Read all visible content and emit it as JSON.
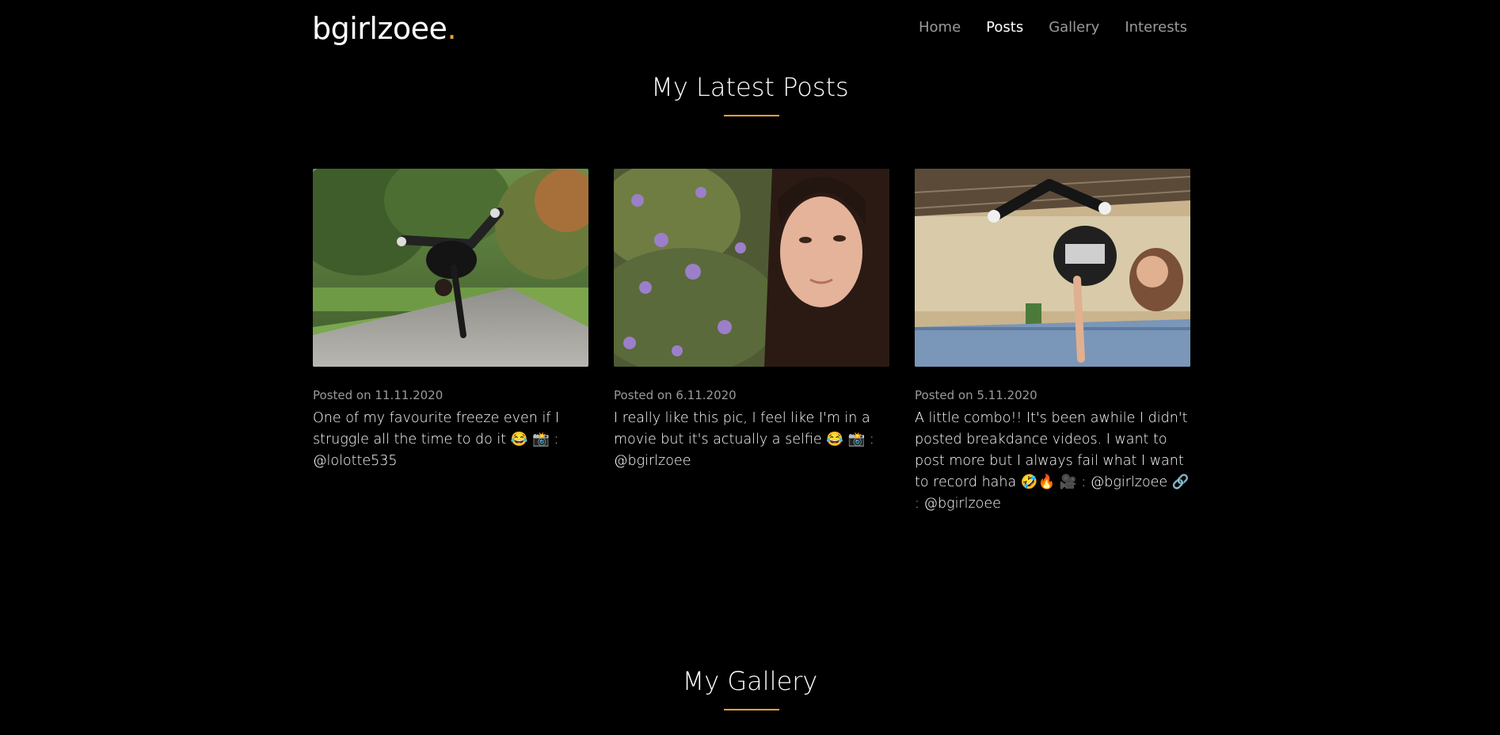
{
  "header": {
    "brand_text": "bgirlzoee",
    "brand_dot": ".",
    "nav": [
      {
        "label": "Home"
      },
      {
        "label": "Posts"
      },
      {
        "label": "Gallery"
      },
      {
        "label": "Interests"
      }
    ]
  },
  "posts_section": {
    "title": "My Latest Posts",
    "posts": [
      {
        "posted_on_label": "Posted on",
        "date": "11.11.2020",
        "text": "One of my favourite freeze even if I struggle all the time to do it 😂 📸 : @lolotte535"
      },
      {
        "posted_on_label": "Posted on",
        "date": "6.11.2020",
        "text": "I really like this pic, I feel like I'm in a movie but it's actually a selfie 😂 📸 : @bgirlzoee"
      },
      {
        "posted_on_label": "Posted on",
        "date": "5.11.2020",
        "text": "A little combo!! It's been awhile I didn't posted breakdance videos. I want to post more but I always fail what I want to record haha 🤣🔥 🎥 : @bgirlzoee 🔗 : @bgirlzoee"
      }
    ]
  },
  "gallery_section": {
    "title": "My Gallery"
  },
  "colors": {
    "background": "#000000",
    "accent": "#f0a23b",
    "muted_text": "#9a9a9a"
  }
}
